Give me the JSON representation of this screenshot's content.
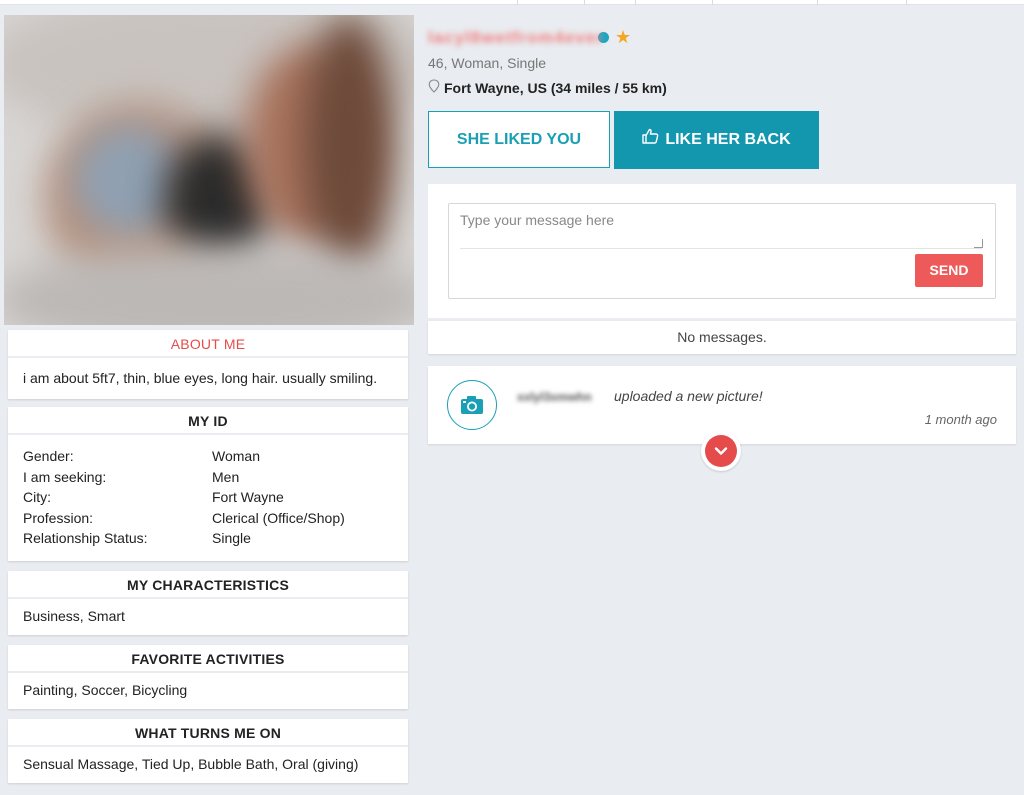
{
  "profile": {
    "username": "lacyl8wetfrom4ever",
    "sub_info": "46, Woman, Single",
    "location": "Fort Wayne, US (34 miles / 55 km)"
  },
  "actions": {
    "liked_label": "SHE LIKED YOU",
    "like_back_label": "LIKE HER BACK"
  },
  "messages": {
    "placeholder": "Type your message here",
    "send_label": "SEND",
    "empty_text": "No messages."
  },
  "activity": {
    "user": "xxlyl3xmwhn",
    "text": "uploaded a new picture!",
    "time": "1 month ago"
  },
  "about": {
    "title": "ABOUT ME",
    "text": "i am about 5ft7, thin, blue eyes, long hair. usually smiling."
  },
  "my_id": {
    "title": "MY ID",
    "rows": [
      {
        "key": "Gender:",
        "value": "Woman"
      },
      {
        "key": "I am seeking:",
        "value": "Men"
      },
      {
        "key": "City:",
        "value": "Fort Wayne"
      },
      {
        "key": "Profession:",
        "value": "Clerical (Office/Shop)"
      },
      {
        "key": "Relationship Status:",
        "value": "Single"
      }
    ]
  },
  "characteristics": {
    "title": "MY CHARACTERISTICS",
    "text": "Business, Smart"
  },
  "activities": {
    "title": "FAVORITE ACTIVITIES",
    "text": "Painting, Soccer, Bicycling"
  },
  "turn_ons": {
    "title": "WHAT TURNS ME ON",
    "text": "Sensual Massage, Tied Up, Bubble Bath, Oral (giving)"
  },
  "colors": {
    "accent_teal": "#1397ae",
    "accent_red": "#ee5a5a",
    "online": "#1aa6c2",
    "star": "#f5a623"
  },
  "icons": [
    "online-status-icon",
    "star-icon",
    "location-pin-icon",
    "thumbs-up-icon",
    "camera-icon",
    "chevron-down-icon"
  ]
}
